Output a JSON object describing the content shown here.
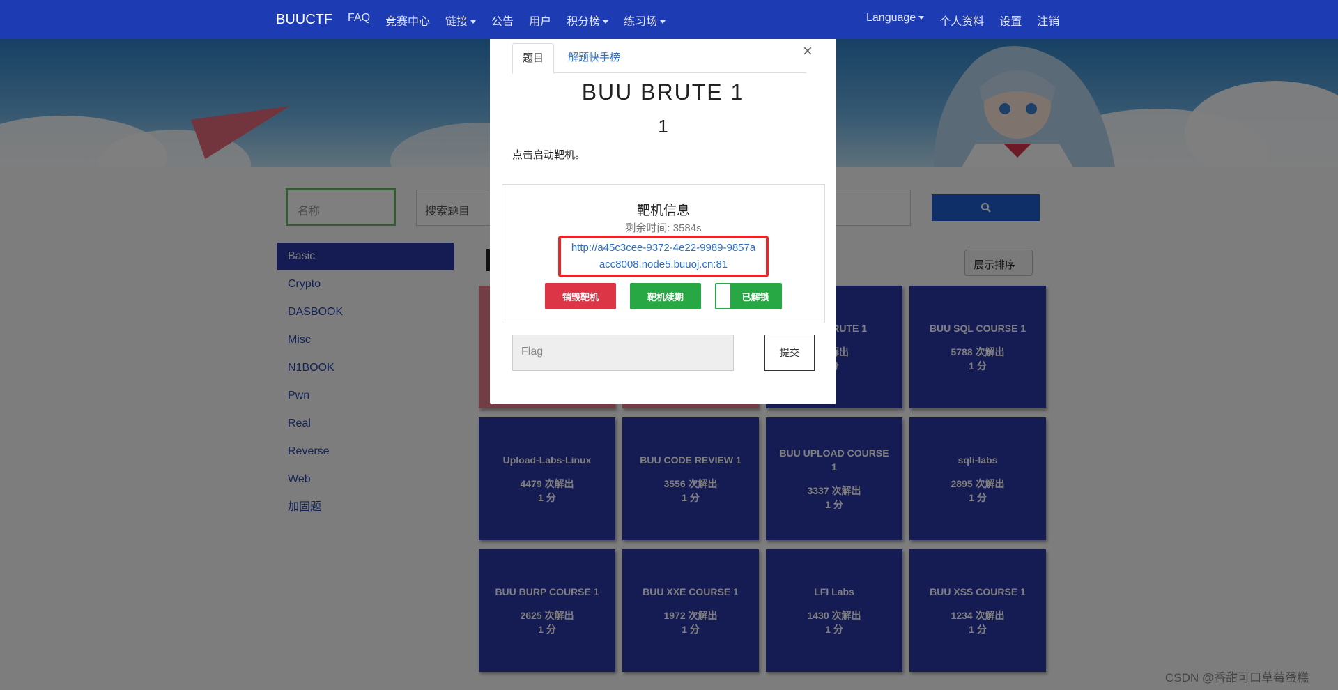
{
  "navbar": {
    "brand": "BUUCTF",
    "links": [
      "FAQ",
      "竞赛中心",
      "链接",
      "公告",
      "用户",
      "积分榜",
      "练习场"
    ],
    "right": [
      "Language",
      "个人资料",
      "设置",
      "注销"
    ]
  },
  "search": {
    "name_placeholder": "名称",
    "title_placeholder": "搜索题目",
    "button_icon": "search-icon"
  },
  "sidebar": {
    "items": [
      {
        "label": "Basic",
        "active": true
      },
      {
        "label": "Crypto",
        "active": false
      },
      {
        "label": "DASBOOK",
        "active": false
      },
      {
        "label": "Misc",
        "active": false
      },
      {
        "label": "N1BOOK",
        "active": false
      },
      {
        "label": "Pwn",
        "active": false
      },
      {
        "label": "Real",
        "active": false
      },
      {
        "label": "Reverse",
        "active": false
      },
      {
        "label": "Web",
        "active": false
      },
      {
        "label": "加固题",
        "active": false
      }
    ]
  },
  "sort": {
    "label": "展示排序"
  },
  "cards": [
    {
      "name": "",
      "solves": "",
      "score": "",
      "pink": true
    },
    {
      "name": "",
      "solves": "",
      "score": "",
      "pink": true
    },
    {
      "name": "BUU BRUTE 1",
      "solves": "次解出",
      "score": "分",
      "pink": false
    },
    {
      "name": "BUU SQL COURSE 1",
      "solves": "5788 次解出",
      "score": "1 分",
      "pink": false
    },
    {
      "name": "Upload-Labs-Linux",
      "solves": "4479 次解出",
      "score": "1 分",
      "pink": false
    },
    {
      "name": "BUU CODE REVIEW 1",
      "solves": "3556 次解出",
      "score": "1 分",
      "pink": false
    },
    {
      "name": "BUU UPLOAD COURSE 1",
      "solves": "3337 次解出",
      "score": "1 分",
      "pink": false
    },
    {
      "name": "sqli-labs",
      "solves": "2895 次解出",
      "score": "1 分",
      "pink": false
    },
    {
      "name": "BUU BURP COURSE 1",
      "solves": "2625 次解出",
      "score": "1 分",
      "pink": false
    },
    {
      "name": "BUU XXE COURSE 1",
      "solves": "1972 次解出",
      "score": "1 分",
      "pink": false
    },
    {
      "name": "LFI Labs",
      "solves": "1430 次解出",
      "score": "1 分",
      "pink": false
    },
    {
      "name": "BUU XSS COURSE 1",
      "solves": "1234 次解出",
      "score": "1 分",
      "pink": false
    }
  ],
  "modal": {
    "tabs": [
      "题目",
      "解题快手榜"
    ],
    "close": "×",
    "title": "BUU BRUTE 1",
    "score": "1",
    "description": "点击启动靶机。",
    "info": {
      "title": "靶机信息",
      "time": "剩余时间: 3584s",
      "url": "http://a45c3cee-9372-4e22-9989-9857aacc8008.node5.buuoj.cn:81"
    },
    "buttons": {
      "destroy": "销毁靶机",
      "renew": "靶机续期",
      "unlocked": "已解锁"
    },
    "flag_placeholder": "Flag",
    "submit": "提交"
  },
  "watermark": "CSDN @香甜可口草莓蛋糕",
  "colors": {
    "navbar": "#1d3bb3",
    "card": "#2b36a6",
    "danger": "#dc3545",
    "success": "#28a745",
    "link": "#2b6fc9"
  }
}
